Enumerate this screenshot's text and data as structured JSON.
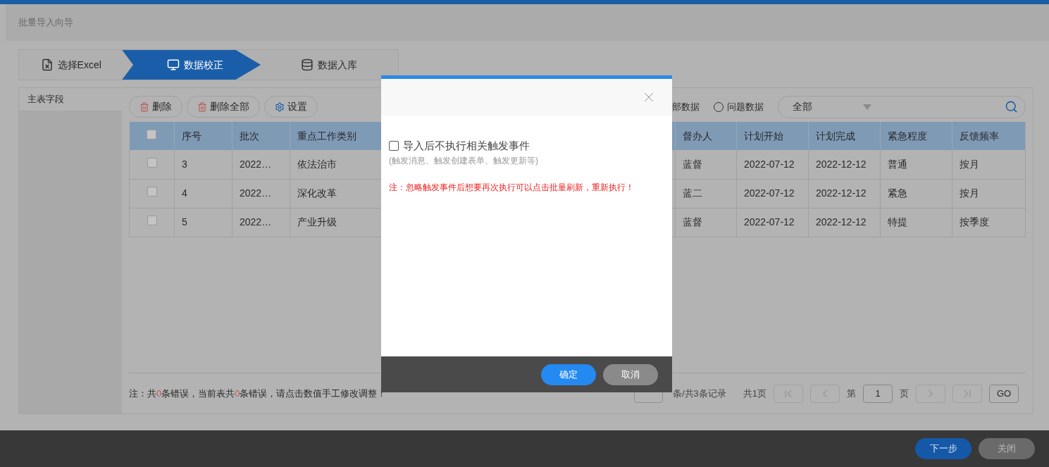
{
  "window": {
    "title": "批量导入向导"
  },
  "steps": [
    {
      "label": "选择Excel",
      "selected": false,
      "kind": "excel"
    },
    {
      "label": "数据校正",
      "selected": true,
      "kind": "check"
    },
    {
      "label": "数据入库",
      "selected": false,
      "kind": "database"
    }
  ],
  "sidebar": {
    "title": "主表字段"
  },
  "toolbar": {
    "buttons": [
      {
        "label": "删除",
        "kind": "delete"
      },
      {
        "label": "删除全部",
        "kind": "delete"
      },
      {
        "label": "设置",
        "kind": "settings"
      }
    ],
    "filter_all_label": "部数据",
    "filter_problem": {
      "label": "问题数据",
      "selected": false
    },
    "select": {
      "value": "全部"
    }
  },
  "table": {
    "header_checked": false,
    "columns": [
      "序号",
      "批次",
      "重点工作类别",
      "督办人",
      "计划开始",
      "计划完成",
      "紧急程度",
      "反馈频率"
    ],
    "rows": [
      {
        "checked": false,
        "cells": [
          "3",
          "2022…",
          "依法治市",
          "蓝督",
          "2022-07-12",
          "2022-12-12",
          "普通",
          "按月"
        ]
      },
      {
        "checked": false,
        "cells": [
          "4",
          "2022…",
          "深化改革",
          "蓝二",
          "2022-07-12",
          "2022-12-12",
          "紧急",
          "按月"
        ]
      },
      {
        "checked": false,
        "cells": [
          "5",
          "2022…",
          "产业升级",
          "蓝督",
          "2022-07-12",
          "2022-12-12",
          "特提",
          "按季度"
        ]
      }
    ]
  },
  "note": [
    {
      "text": "注：共",
      "kind": "plain"
    },
    {
      "text": "0",
      "kind": "count"
    },
    {
      "text": "条错误，当前表共",
      "kind": "plain"
    },
    {
      "text": "0",
      "kind": "count"
    },
    {
      "text": "条错误，请点击数值手工修改调整！",
      "kind": "plain"
    }
  ],
  "pagination": {
    "summary": "条/共3条记录",
    "total_pages": "共1页",
    "page_prefix": "第",
    "page": "1",
    "page_suffix": "页",
    "go": "GO"
  },
  "footer_buttons": [
    {
      "label": "下一步",
      "kind": "primary"
    },
    {
      "label": "关闭",
      "kind": "secondary"
    }
  ],
  "modal": {
    "checkbox": {
      "label": "导入后不执行相关触发事件",
      "checked": false
    },
    "hint": "(触发消息、触发创建表单、触发更新等)",
    "warning": "注：忽略触发事件后想要再次执行可以点击批量刷新，重新执行！",
    "buttons": [
      {
        "label": "确定",
        "kind": "primary"
      },
      {
        "label": "取消",
        "kind": "secondary"
      }
    ]
  }
}
